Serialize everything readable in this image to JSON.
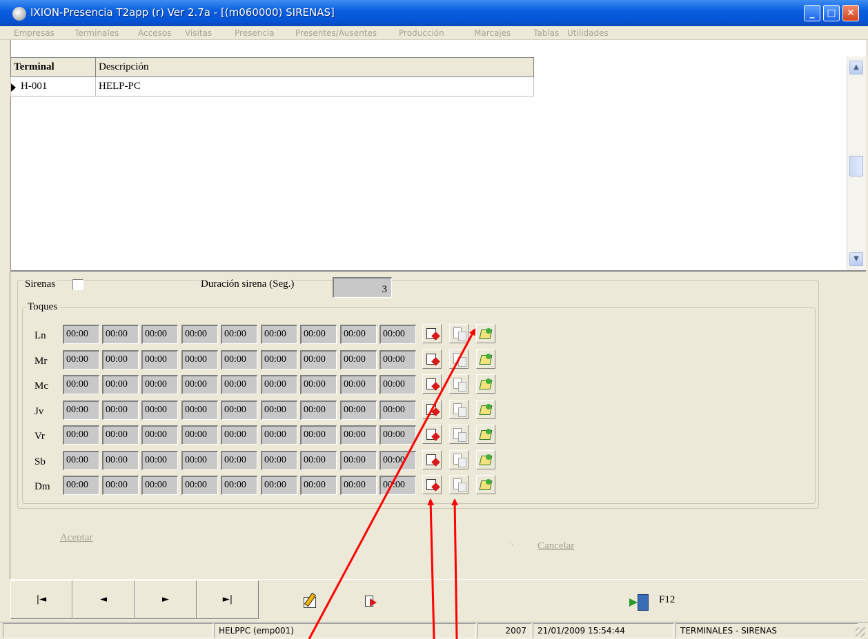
{
  "window": {
    "title": "IXION-Presencia T2app (r) Ver 2.7a - [(m060000)  SIRENAS]",
    "controls": [
      "minimize",
      "maximize",
      "close"
    ]
  },
  "menu": [
    "Empresas",
    "Terminales",
    "Accesos",
    "Visitas",
    "Presencia",
    "Presentes/Ausentes",
    "Producción",
    "Marcajes",
    "Tablas",
    "Utilidades"
  ],
  "grid": {
    "columns": [
      "Terminal",
      "Descripción"
    ],
    "rows": [
      {
        "terminal": "H-001",
        "descripcion": "HELP-PC"
      }
    ]
  },
  "form": {
    "sirenas_label": "Sirenas",
    "sirenas_checked": false,
    "duracion_label": "Duración sirena (Seg.)",
    "duracion_value": "3",
    "toques_label": "Toques",
    "days": [
      {
        "label": "Ln",
        "times": [
          "00:00",
          "00:00",
          "00:00",
          "00:00",
          "00:00",
          "00:00",
          "00:00",
          "00:00",
          "00:00"
        ]
      },
      {
        "label": "Mr",
        "times": [
          "00:00",
          "00:00",
          "00:00",
          "00:00",
          "00:00",
          "00:00",
          "00:00",
          "00:00",
          "00:00"
        ]
      },
      {
        "label": "Mc",
        "times": [
          "00:00",
          "00:00",
          "00:00",
          "00:00",
          "00:00",
          "00:00",
          "00:00",
          "00:00",
          "00:00"
        ]
      },
      {
        "label": "Jv",
        "times": [
          "00:00",
          "00:00",
          "00:00",
          "00:00",
          "00:00",
          "00:00",
          "00:00",
          "00:00",
          "00:00"
        ]
      },
      {
        "label": "Vr",
        "times": [
          "00:00",
          "00:00",
          "00:00",
          "00:00",
          "00:00",
          "00:00",
          "00:00",
          "00:00",
          "00:00"
        ]
      },
      {
        "label": "Sb",
        "times": [
          "00:00",
          "00:00",
          "00:00",
          "00:00",
          "00:00",
          "00:00",
          "00:00",
          "00:00",
          "00:00"
        ]
      },
      {
        "label": "Dm",
        "times": [
          "00:00",
          "00:00",
          "00:00",
          "00:00",
          "00:00",
          "00:00",
          "00:00",
          "00:00",
          "00:00"
        ]
      }
    ],
    "row_buttons": [
      "clear-row-icon",
      "copy-row-icon",
      "paste-row-icon"
    ],
    "accept_label": "Aceptar",
    "cancel_label": "Cancelar"
  },
  "navbar": {
    "first": "first-record-icon",
    "prev": "prev-record-icon",
    "next": "next-record-icon",
    "last": "last-record-icon",
    "edit": "edit-icon",
    "export": "export-icon",
    "exit_label": "F12"
  },
  "status": {
    "user": "HELPPC  (emp001)",
    "year": "2007",
    "datetime": "21/01/2009  15:54:44",
    "module": "TERMINALES - SIRENAS"
  },
  "colors": {
    "title_bar": "#0654d6",
    "window_bg": "#ece9d8",
    "field_bg": "#c8c8c8",
    "annotation_arrows": "#ff0000"
  }
}
